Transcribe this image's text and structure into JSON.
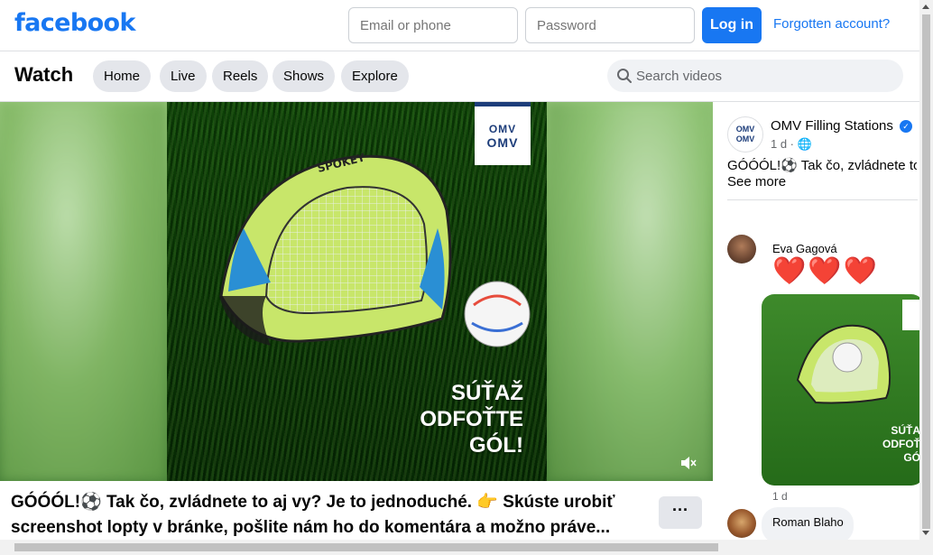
{
  "header": {
    "logo": "facebook",
    "email_placeholder": "Email or phone",
    "password_placeholder": "Password",
    "login_label": "Log in",
    "forgot_label": "Forgotten account?"
  },
  "watch": {
    "title": "Watch",
    "tabs": [
      "Home",
      "Live",
      "Reels",
      "Shows",
      "Explore"
    ],
    "search_placeholder": "Search videos"
  },
  "video": {
    "brand_top": "OMV",
    "brand_bottom": "OMV",
    "promo_lines": [
      "SÚŤAŽ",
      "ODFOŤTE",
      "GÓL!"
    ],
    "caption": "GÓÓÓL!⚽ Tak čo, zvládnete to aj vy? Je to jednoduché. 👉 Skúste urobiť\nscreenshot lopty v bránke, pošlite nám ho do komentára a možno práve...",
    "more_label": "···"
  },
  "sidebar": {
    "page_name": "OMV Filling Stations",
    "page_avatar_top": "OMV",
    "page_avatar_bottom": "OMV",
    "post_time": "1 d ·",
    "post_text": "GÓÓÓL!⚽ Tak čo, zvládnete to",
    "see_more": "See more",
    "comments": [
      {
        "name": "Eva Gagová",
        "text": "❤️❤️❤️",
        "time": "1 d"
      },
      {
        "name": "Roman Blaho"
      }
    ],
    "thumb_promo": [
      "SÚŤA",
      "ODFOŤ",
      "GÓ"
    ]
  },
  "colors": {
    "brand": "#1877f2",
    "omv_blue": "#1d3d7a"
  }
}
